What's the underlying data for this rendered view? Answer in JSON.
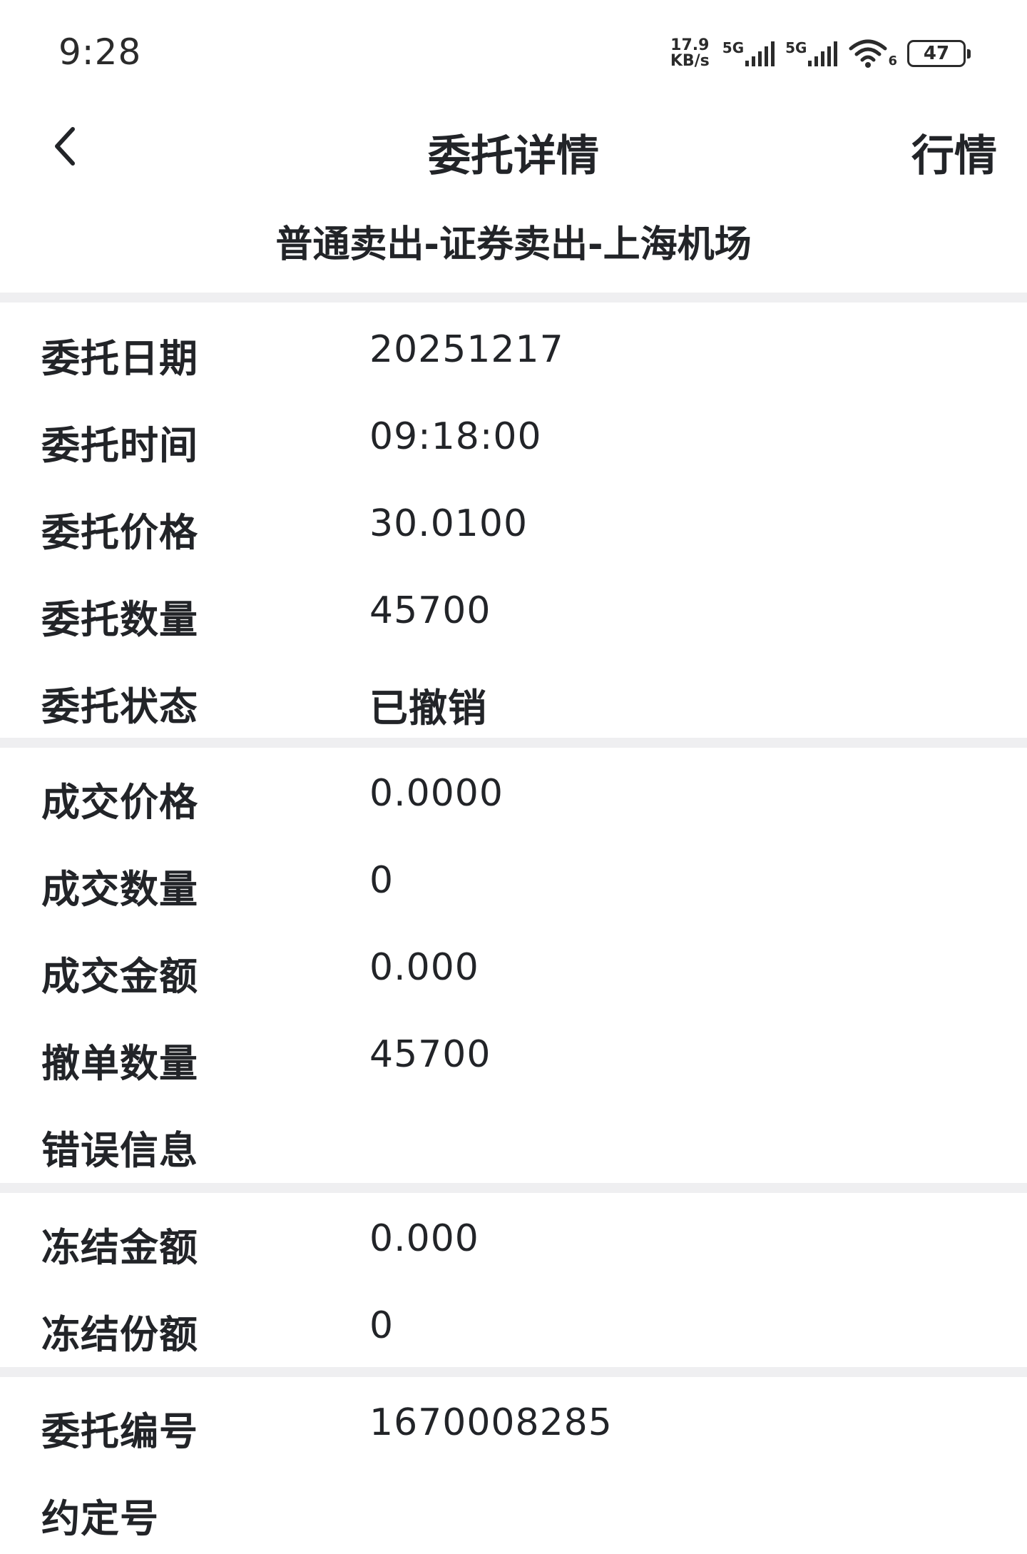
{
  "status_bar": {
    "time": "9:28",
    "net_speed_value": "17.9",
    "net_speed_unit": "KB/s",
    "sim1_label": "5G",
    "sim2_label": "5G",
    "wifi_sub": "6",
    "battery": "47"
  },
  "nav": {
    "title": "委托详情",
    "market_label": "行情"
  },
  "subtitle": "普通卖出-证券卖出-上海机场",
  "section1": [
    {
      "label": "委托日期",
      "value": "20251217"
    },
    {
      "label": "委托时间",
      "value": "09:18:00"
    },
    {
      "label": "委托价格",
      "value": "30.0100"
    },
    {
      "label": "委托数量",
      "value": "45700"
    },
    {
      "label": "委托状态",
      "value": "已撤销"
    }
  ],
  "section2": [
    {
      "label": "成交价格",
      "value": "0.0000"
    },
    {
      "label": "成交数量",
      "value": "0"
    },
    {
      "label": "成交金额",
      "value": "0.000"
    },
    {
      "label": "撤单数量",
      "value": "45700"
    },
    {
      "label": "错误信息",
      "value": ""
    }
  ],
  "section3": [
    {
      "label": "冻结金额",
      "value": "0.000"
    },
    {
      "label": "冻结份额",
      "value": "0"
    }
  ],
  "section4": [
    {
      "label": "委托编号",
      "value": "1670008285"
    },
    {
      "label": "约定号",
      "value": ""
    }
  ]
}
